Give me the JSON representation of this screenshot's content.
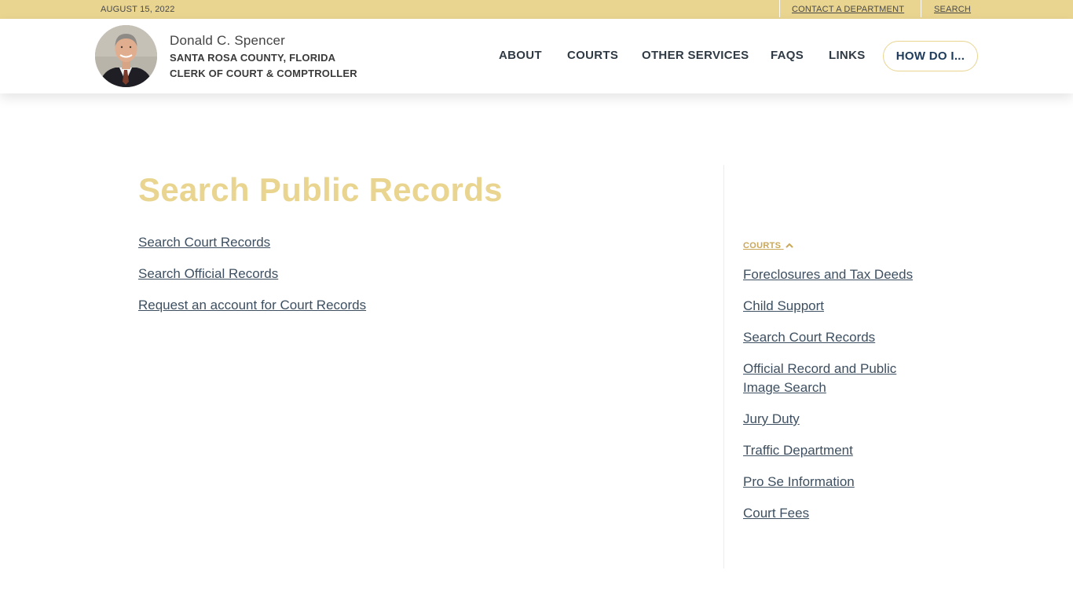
{
  "topbar": {
    "date": "AUGUST 15, 2022",
    "contact": "CONTACT A DEPARTMENT",
    "search": "SEARCH"
  },
  "brand": {
    "name": "Donald C. Spencer",
    "line1": "SANTA ROSA COUNTY, FLORIDA",
    "line2": "CLERK OF COURT & COMPTROLLER"
  },
  "nav": {
    "items": [
      "ABOUT",
      "COURTS",
      "OTHER SERVICES",
      "FAQS",
      "LINKS"
    ],
    "cta": "HOW DO I..."
  },
  "main": {
    "title": "Search Public Records",
    "links": [
      "Search Court Records",
      "Search Official Records",
      "Request an account for Court Records"
    ]
  },
  "sidebar": {
    "heading": "COURTS",
    "links": [
      "Foreclosures and Tax Deeds",
      "Child Support",
      "Search Court Records",
      "Official Record and Public Image Search",
      "Jury Duty",
      "Traffic Department",
      "Pro Se Information",
      "Court Fees"
    ]
  },
  "colors": {
    "gold": "#e9d590",
    "link": "#3d4f60",
    "nav_text": "#2f3a44"
  }
}
